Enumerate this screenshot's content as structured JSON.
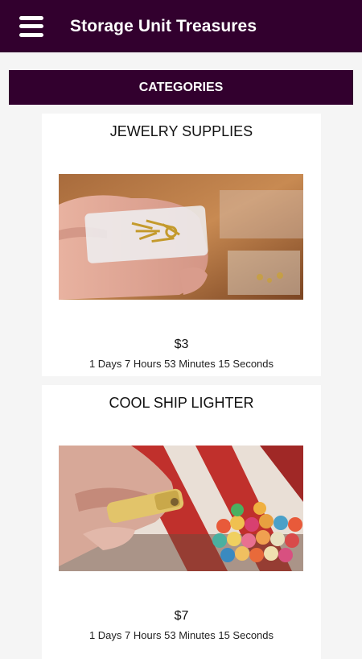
{
  "app_bar": {
    "title": "Storage Unit Treasures",
    "menu_icon": "hamburger-menu-icon",
    "color": "#32002e"
  },
  "categories_button": {
    "label": "CATEGORIES"
  },
  "items": [
    {
      "title": "JEWELRY SUPPLIES",
      "price": "$3",
      "time_left": "1 Days 7 Hours 53 Minutes 15 Seconds"
    },
    {
      "title": "COOL SHIP LIGHTER",
      "price": "$7",
      "time_left": "1 Days 7 Hours 53 Minutes 15 Seconds"
    }
  ]
}
